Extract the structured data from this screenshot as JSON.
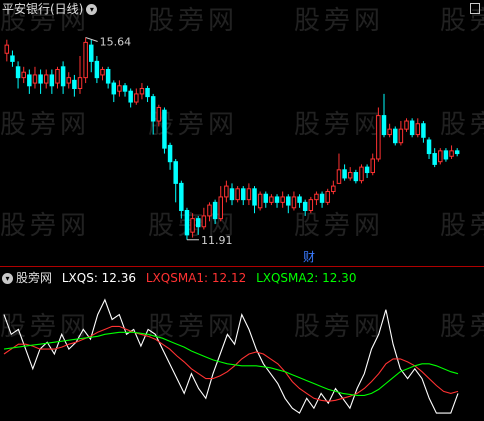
{
  "watermark": "股旁网",
  "top_panel": {
    "title": "平安银行(日线)",
    "high_label": "15.64",
    "low_label": "11.91",
    "event_marker": "财"
  },
  "bottom_panel": {
    "name": "股旁网",
    "ind1": "LXQS: 12.36",
    "ind2": "LXQSMA1: 12.12",
    "ind3": "LXQSMA2: 12.30"
  },
  "colors": {
    "up": "#ff3232",
    "down": "#00ffff",
    "ind1": "#ffffff",
    "ind2": "#ff3232",
    "ind3": "#00ff00",
    "separator": "#b00000"
  },
  "chart_data": [
    {
      "type": "candlestick",
      "title": "平安银行(日线)",
      "ylim": [
        11.5,
        16.0
      ],
      "annotations": [
        {
          "label": "15.64",
          "value": 15.64
        },
        {
          "label": "11.91",
          "value": 11.91
        }
      ],
      "candles": [
        [
          15.35,
          15.5,
          15.2,
          15.6
        ],
        [
          15.3,
          15.2,
          15.1,
          15.4
        ],
        [
          15.1,
          14.9,
          14.7,
          15.2
        ],
        [
          14.9,
          15.0,
          14.8,
          15.1
        ],
        [
          14.95,
          14.75,
          14.6,
          15.05
        ],
        [
          14.8,
          14.95,
          14.7,
          15.1
        ],
        [
          14.95,
          14.8,
          14.6,
          15.05
        ],
        [
          14.8,
          14.95,
          14.7,
          15.05
        ],
        [
          14.95,
          14.75,
          14.6,
          15.05
        ],
        [
          14.8,
          15.05,
          14.7,
          15.1
        ],
        [
          15.1,
          14.75,
          14.6,
          15.2
        ],
        [
          14.8,
          14.9,
          14.7,
          15.0
        ],
        [
          14.85,
          14.7,
          14.55,
          14.95
        ],
        [
          14.7,
          14.9,
          14.6,
          15.3
        ],
        [
          14.9,
          15.55,
          14.8,
          15.64
        ],
        [
          15.5,
          15.2,
          15.0,
          15.6
        ],
        [
          15.2,
          14.9,
          14.8,
          15.3
        ],
        [
          14.95,
          15.05,
          14.85,
          15.1
        ],
        [
          15.05,
          14.8,
          14.7,
          15.1
        ],
        [
          14.8,
          14.6,
          14.45,
          14.85
        ],
        [
          14.65,
          14.75,
          14.55,
          14.85
        ],
        [
          14.75,
          14.65,
          14.55,
          14.8
        ],
        [
          14.65,
          14.45,
          14.35,
          14.7
        ],
        [
          14.45,
          14.6,
          14.4,
          14.7
        ],
        [
          14.6,
          14.7,
          14.5,
          14.8
        ],
        [
          14.7,
          14.55,
          14.45,
          14.75
        ],
        [
          14.55,
          14.1,
          13.85,
          14.6
        ],
        [
          14.1,
          14.35,
          14.0,
          14.4
        ],
        [
          14.3,
          13.6,
          13.5,
          14.35
        ],
        [
          13.65,
          13.35,
          13.2,
          13.7
        ],
        [
          13.35,
          12.95,
          12.6,
          13.4
        ],
        [
          12.95,
          12.45,
          12.3,
          13.0
        ],
        [
          12.45,
          12.0,
          11.91,
          12.5
        ],
        [
          12.05,
          12.3,
          11.95,
          12.4
        ],
        [
          12.3,
          12.15,
          12.0,
          12.35
        ],
        [
          12.15,
          12.35,
          12.1,
          12.5
        ],
        [
          12.35,
          12.55,
          12.25,
          12.6
        ],
        [
          12.6,
          12.3,
          12.2,
          12.65
        ],
        [
          12.3,
          12.7,
          12.25,
          12.9
        ],
        [
          12.7,
          12.9,
          12.6,
          13.0
        ],
        [
          12.85,
          12.65,
          12.55,
          12.95
        ],
        [
          12.65,
          12.85,
          12.6,
          12.9
        ],
        [
          12.85,
          12.65,
          12.55,
          12.9
        ],
        [
          12.65,
          12.85,
          12.55,
          12.95
        ],
        [
          12.85,
          12.55,
          12.4,
          12.9
        ],
        [
          12.5,
          12.75,
          12.45,
          12.8
        ],
        [
          12.75,
          12.6,
          12.5,
          12.8
        ],
        [
          12.6,
          12.7,
          12.55,
          12.75
        ],
        [
          12.7,
          12.6,
          12.5,
          12.75
        ],
        [
          12.6,
          12.7,
          12.5,
          12.8
        ],
        [
          12.7,
          12.55,
          12.4,
          12.75
        ],
        [
          12.5,
          12.7,
          12.45,
          12.8
        ],
        [
          12.7,
          12.6,
          12.5,
          12.75
        ],
        [
          12.6,
          12.45,
          12.35,
          12.65
        ],
        [
          12.45,
          12.65,
          12.4,
          12.7
        ],
        [
          12.65,
          12.75,
          12.55,
          12.8
        ],
        [
          12.75,
          12.6,
          12.5,
          12.8
        ],
        [
          12.6,
          12.8,
          12.55,
          12.85
        ],
        [
          12.8,
          12.9,
          12.75,
          13.0
        ],
        [
          12.95,
          13.2,
          12.95,
          13.5
        ],
        [
          13.2,
          13.05,
          13.0,
          13.3
        ],
        [
          13.05,
          13.15,
          13.0,
          13.25
        ],
        [
          13.15,
          13.0,
          12.95,
          13.2
        ],
        [
          13.0,
          13.25,
          12.95,
          13.3
        ],
        [
          13.25,
          13.15,
          13.05,
          13.3
        ],
        [
          13.15,
          13.4,
          13.1,
          13.5
        ],
        [
          13.4,
          14.2,
          13.35,
          14.35
        ],
        [
          14.2,
          13.85,
          13.8,
          14.6
        ],
        [
          13.85,
          13.95,
          13.8,
          14.05
        ],
        [
          13.95,
          13.7,
          13.65,
          14.0
        ],
        [
          13.7,
          13.95,
          13.65,
          14.1
        ],
        [
          13.95,
          14.1,
          13.9,
          14.15
        ],
        [
          14.1,
          13.85,
          13.8,
          14.15
        ],
        [
          13.85,
          14.05,
          13.8,
          14.15
        ],
        [
          14.05,
          13.8,
          13.7,
          14.1
        ],
        [
          13.75,
          13.5,
          13.4,
          13.8
        ],
        [
          13.5,
          13.3,
          13.25,
          13.6
        ],
        [
          13.35,
          13.55,
          13.3,
          13.6
        ],
        [
          13.55,
          13.4,
          13.35,
          13.6
        ],
        [
          13.45,
          13.55,
          13.4,
          13.65
        ],
        [
          13.55,
          13.5,
          13.45,
          13.6
        ]
      ]
    },
    {
      "type": "line",
      "series": [
        {
          "name": "LXQS",
          "values": [
            12.9,
            12.7,
            12.75,
            12.55,
            12.35,
            12.55,
            12.62,
            12.5,
            12.7,
            12.55,
            12.62,
            12.75,
            12.65,
            12.9,
            13.05,
            12.85,
            12.9,
            12.7,
            12.75,
            12.58,
            12.75,
            12.7,
            12.55,
            12.4,
            12.25,
            12.1,
            12.3,
            12.15,
            12.05,
            12.3,
            12.5,
            12.7,
            12.6,
            12.9,
            12.75,
            12.55,
            12.4,
            12.3,
            12.2,
            12.05,
            11.95,
            11.9,
            12.05,
            11.95,
            12.1,
            12.0,
            12.15,
            12.05,
            11.95,
            12.15,
            12.3,
            12.55,
            12.7,
            12.95,
            12.6,
            12.35,
            12.25,
            12.35,
            12.25,
            12.05,
            11.9,
            11.9,
            11.9,
            12.1
          ]
        },
        {
          "name": "LXQSMA1",
          "values": [
            12.5,
            12.55,
            12.6,
            12.6,
            12.58,
            12.55,
            12.55,
            12.55,
            12.57,
            12.6,
            12.62,
            12.65,
            12.68,
            12.72,
            12.75,
            12.78,
            12.78,
            12.75,
            12.72,
            12.7,
            12.68,
            12.65,
            12.6,
            12.55,
            12.48,
            12.42,
            12.35,
            12.3,
            12.25,
            12.25,
            12.28,
            12.32,
            12.38,
            12.45,
            12.5,
            12.52,
            12.5,
            12.45,
            12.4,
            12.32,
            12.22,
            12.15,
            12.1,
            12.05,
            12.03,
            12.02,
            12.03,
            12.05,
            12.07,
            12.1,
            12.15,
            12.22,
            12.3,
            12.4,
            12.45,
            12.45,
            12.42,
            12.38,
            12.32,
            12.25,
            12.18,
            12.12,
            12.1,
            12.12
          ]
        },
        {
          "name": "LXQSMA2",
          "values": [
            12.55,
            12.56,
            12.57,
            12.58,
            12.59,
            12.6,
            12.61,
            12.62,
            12.63,
            12.64,
            12.65,
            12.66,
            12.67,
            12.68,
            12.7,
            12.71,
            12.72,
            12.72,
            12.72,
            12.71,
            12.7,
            12.68,
            12.66,
            12.63,
            12.6,
            12.57,
            12.53,
            12.5,
            12.47,
            12.44,
            12.42,
            12.4,
            12.39,
            12.38,
            12.38,
            12.38,
            12.37,
            12.36,
            12.34,
            12.32,
            12.29,
            12.26,
            12.23,
            12.2,
            12.17,
            12.14,
            12.12,
            12.1,
            12.09,
            12.08,
            12.08,
            12.1,
            12.14,
            12.2,
            12.26,
            12.32,
            12.35,
            12.38,
            12.4,
            12.4,
            12.38,
            12.35,
            12.32,
            12.3
          ]
        }
      ]
    }
  ]
}
